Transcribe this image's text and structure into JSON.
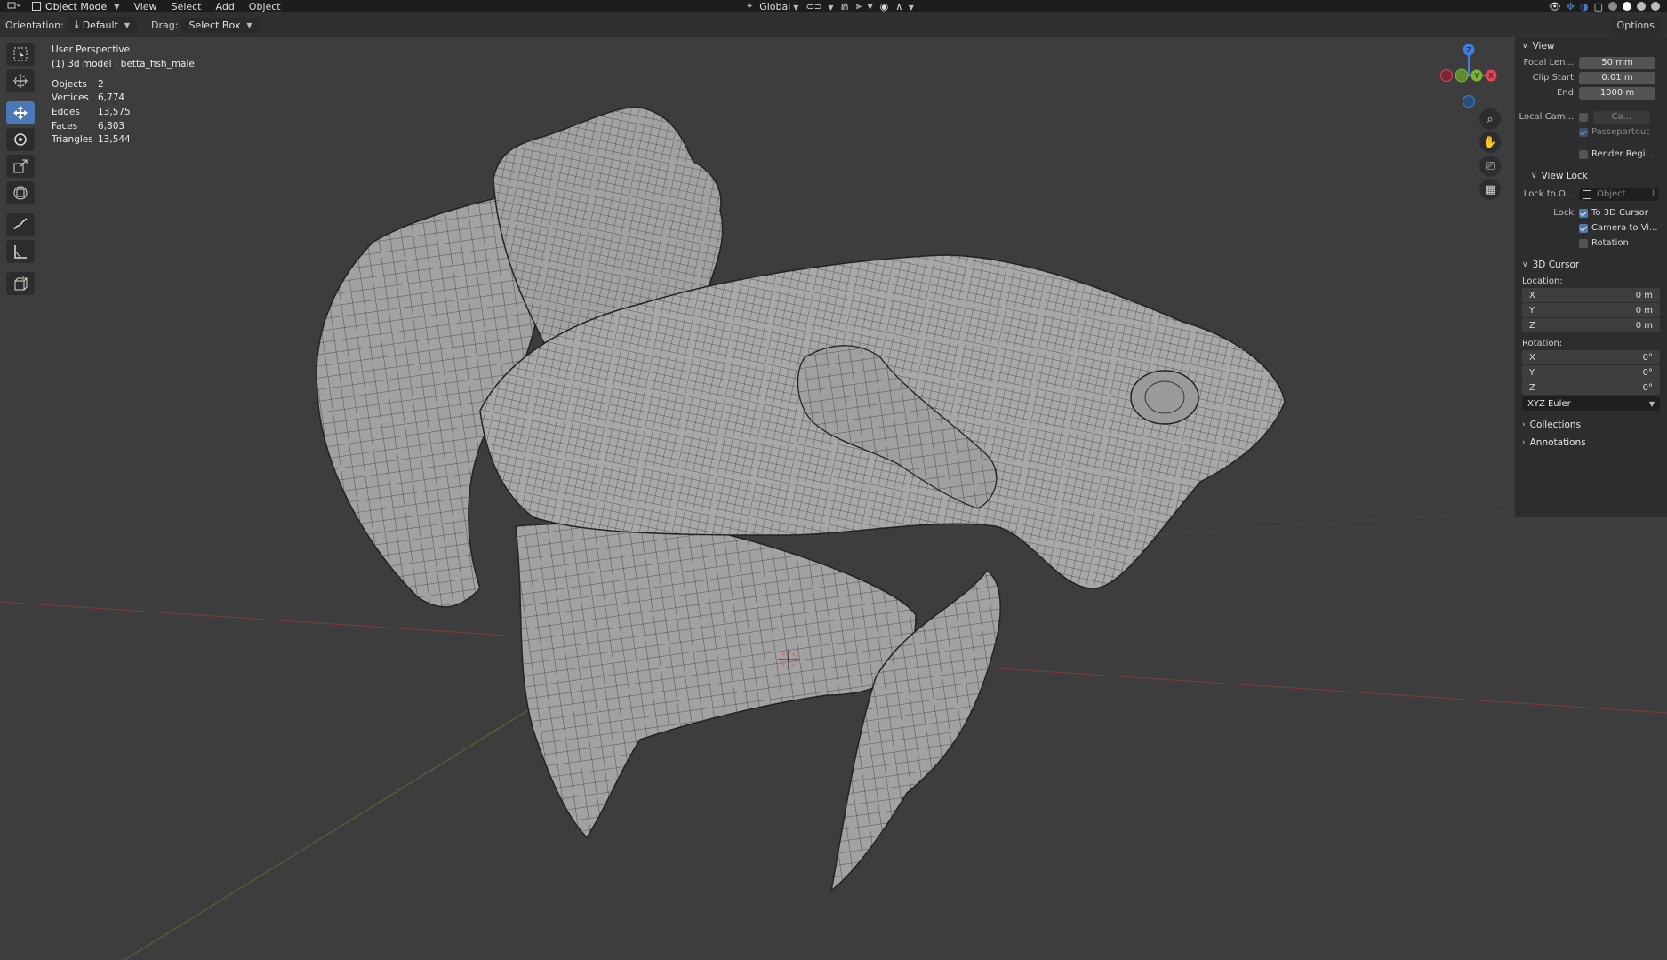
{
  "topbar": {
    "mode": "Object Mode",
    "menus": [
      "View",
      "Select",
      "Add",
      "Object"
    ],
    "transform_orientation": "Global"
  },
  "toolbar_row": {
    "orientation_label": "Orientation:",
    "orientation_value": "Default",
    "drag_label": "Drag:",
    "drag_value": "Select Box",
    "options_label": "Options"
  },
  "viewport": {
    "perspective": "User Perspective",
    "object_info": "(1) 3d model | betta_fish_male",
    "stats": [
      {
        "label": "Objects",
        "value": "2"
      },
      {
        "label": "Vertices",
        "value": "6,774"
      },
      {
        "label": "Edges",
        "value": "13,575"
      },
      {
        "label": "Faces",
        "value": "6,803"
      },
      {
        "label": "Triangles",
        "value": "13,544"
      }
    ],
    "gizmo_axes": {
      "x": "X",
      "y": "Y",
      "z": "Z"
    }
  },
  "colors": {
    "background": "#3d3d3d",
    "active_tool": "#4a78b8",
    "x_axis": "#e0445a",
    "y_axis": "#7ab536",
    "z_axis": "#3b7ee0"
  },
  "npanel": {
    "view": {
      "title": "View",
      "focal_length_label": "Focal Len...",
      "focal_length": "50 mm",
      "clip_start_label": "Clip Start",
      "clip_start": "0.01 m",
      "end_label": "End",
      "end": "1000 m",
      "local_camera_label": "Local Cam...",
      "local_camera_value": "Ca...",
      "passepartout": "Passepartout",
      "render_region": "Render Regi..."
    },
    "view_lock": {
      "title": "View Lock",
      "lock_to_object_label": "Lock to O...",
      "lock_to_object_placeholder": "Object",
      "lock_label": "Lock",
      "to_3d_cursor": "To 3D Cursor",
      "camera_to_view": "Camera to Vi...",
      "rotation": "Rotation"
    },
    "cursor": {
      "title": "3D Cursor",
      "location_label": "Location:",
      "location": [
        {
          "axis": "X",
          "value": "0 m"
        },
        {
          "axis": "Y",
          "value": "0 m"
        },
        {
          "axis": "Z",
          "value": "0 m"
        }
      ],
      "rotation_label": "Rotation:",
      "rotation": [
        {
          "axis": "X",
          "value": "0°"
        },
        {
          "axis": "Y",
          "value": "0°"
        },
        {
          "axis": "Z",
          "value": "0°"
        }
      ],
      "rotation_mode": "XYZ Euler"
    },
    "collections": "Collections",
    "annotations": "Annotations"
  }
}
